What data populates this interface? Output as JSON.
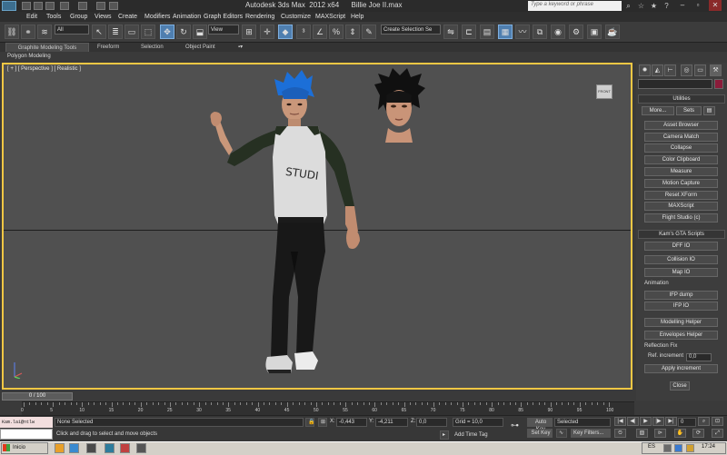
{
  "window": {
    "title": "Autodesk 3ds Max  2012 x64      Billie Joe II.max",
    "search_placeholder": "Type a keyword or phrase"
  },
  "menu": [
    "Edit",
    "Tools",
    "Group",
    "Views",
    "Create",
    "Modifiers",
    "Animation",
    "Graph Editors",
    "Rendering",
    "Customize",
    "MAXScript",
    "Help"
  ],
  "toolbar": {
    "selection_filter": "All",
    "reference_coord": "View",
    "named_selection": "Create Selection Se"
  },
  "ribbon": {
    "tabs": [
      "Graphite Modeling Tools",
      "Freeform",
      "Selection",
      "Object Paint"
    ],
    "panel_label": "Polygon Modeling"
  },
  "viewport": {
    "label": "[ + ] [ Perspective ] [ Realistic ]",
    "viewcube_label": "FRONT",
    "shirt_text": "STUDI"
  },
  "command_panel": {
    "tabs": [
      "create-icon",
      "modify-icon",
      "hierarchy-icon",
      "motion-icon",
      "display-icon",
      "utilities-icon"
    ],
    "utilities": {
      "header": "Utilities",
      "more_label": "More...",
      "sets_label": "Sets",
      "buttons": [
        "Asset Browser",
        "Camera Match",
        "Collapse",
        "Color Clipboard",
        "Measure",
        "Motion Capture",
        "Reset XForm",
        "MAXScript",
        "Flight Studio (c)"
      ]
    },
    "gta_scripts": {
      "header": "Kam's GTA Scripts",
      "buttons": [
        "DFF IO",
        "Collision IO",
        "Map IO"
      ],
      "animation_label": "Animation",
      "animation_buttons": [
        "IFP dump",
        "IFP IO"
      ],
      "helper_buttons": [
        "Modelling Helper",
        "Envelopes Helper"
      ],
      "reflection_label": "Reflection Fix",
      "ref_increment_label": "Ref. increment",
      "ref_increment_value": "0,0",
      "apply_label": "Apply increment",
      "close_label": "Close"
    },
    "accent_color": "#8a1c3a"
  },
  "timeline": {
    "current": "0 / 100",
    "ticks": [
      "0",
      "5",
      "10",
      "15",
      "20",
      "25",
      "30",
      "35",
      "40",
      "45",
      "50",
      "55",
      "60",
      "65",
      "70",
      "75",
      "80",
      "85",
      "90",
      "95",
      "100"
    ]
  },
  "status": {
    "maxscript_text": "Kam.lai@ntlw",
    "selection": "None Selected",
    "prompt": "Click and drag to select and move objects",
    "x_label": "X:",
    "x": "-0,443",
    "y_label": "Y:",
    "y": "-4,211",
    "z_label": "Z:",
    "z": "0,0",
    "grid": "Grid = 10,0",
    "add_time_tag": "Add Time Tag",
    "auto_key": "Auto Key",
    "set_key": "Set Key",
    "key_mode": "Selected",
    "key_filters": "Key Filters...",
    "frame": "0"
  },
  "taskbar": {
    "start": "Inicio",
    "lang": "ES",
    "clock": "17:24"
  }
}
